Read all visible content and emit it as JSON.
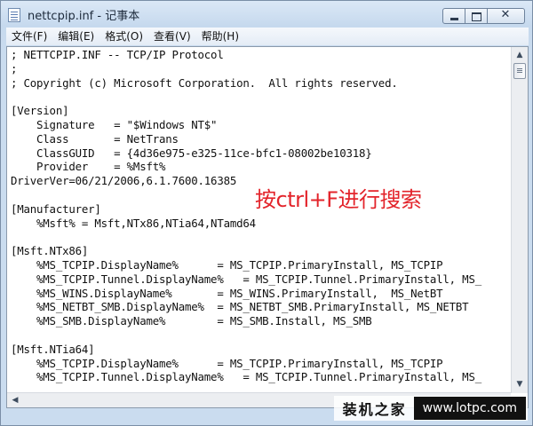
{
  "window": {
    "title": "nettcpip.inf - 记事本",
    "close_glyph": "✕"
  },
  "menu": {
    "items": [
      "文件(F)",
      "编辑(E)",
      "格式(O)",
      "查看(V)",
      "帮助(H)"
    ]
  },
  "editor": {
    "lines": [
      "; NETTCPIP.INF -- TCP/IP Protocol",
      ";",
      "; Copyright (c) Microsoft Corporation.  All rights reserved.",
      "",
      "[Version]",
      "    Signature   = \"$Windows NT$\"",
      "    Class       = NetTrans",
      "    ClassGUID   = {4d36e975-e325-11ce-bfc1-08002be10318}",
      "    Provider    = %Msft%",
      "DriverVer=06/21/2006,6.1.7600.16385",
      "",
      "[Manufacturer]",
      "    %Msft% = Msft,NTx86,NTia64,NTamd64",
      "",
      "[Msft.NTx86]",
      "    %MS_TCPIP.DisplayName%      = MS_TCPIP.PrimaryInstall, MS_TCPIP",
      "    %MS_TCPIP.Tunnel.DisplayName%   = MS_TCPIP.Tunnel.PrimaryInstall, MS_",
      "    %MS_WINS.DisplayName%       = MS_WINS.PrimaryInstall,  MS_NetBT",
      "    %MS_NETBT_SMB.DisplayName%  = MS_NETBT_SMB.PrimaryInstall, MS_NETBT",
      "    %MS_SMB.DisplayName%        = MS_SMB.Install, MS_SMB",
      "",
      "[Msft.NTia64]",
      "    %MS_TCPIP.DisplayName%      = MS_TCPIP.PrimaryInstall, MS_TCPIP",
      "    %MS_TCPIP.Tunnel.DisplayName%   = MS_TCPIP.Tunnel.PrimaryInstall, MS_"
    ]
  },
  "annotation": {
    "text": "按ctrl+F进行搜索",
    "color": "#e3242b"
  },
  "watermark": {
    "name": "装机之家",
    "url": "www.lotpc.com"
  }
}
